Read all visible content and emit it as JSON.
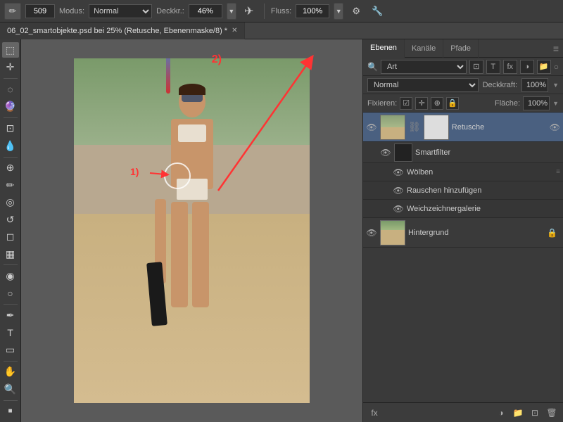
{
  "toolbar": {
    "brush_size": "509",
    "modus_label": "Modus:",
    "modus_value": "Normal",
    "deckkraft_label": "Deckkr.:",
    "deckkraft_value": "46%",
    "fluss_label": "Fluss:",
    "fluss_value": "100%"
  },
  "tab": {
    "title": "06_02_smartobjekte.psd bei 25% (Retusche, Ebenenmaske/8) *"
  },
  "canvas": {
    "annotation_1": "1)",
    "annotation_2": "2)"
  },
  "layers_panel": {
    "tabs": [
      "Ebenen",
      "Kanäle",
      "Pfade"
    ],
    "active_tab": "Ebenen",
    "filter_label": "Art",
    "blend_mode": "Normal",
    "deckkraft_label": "Deckkraft:",
    "deckkraft_value": "100%",
    "fixieren_label": "Fixieren:",
    "flache_label": "Fläche:",
    "flache_value": "100%",
    "layers": [
      {
        "name": "Retusche",
        "type": "layer",
        "active": true,
        "has_mask": true
      },
      {
        "name": "Smartfilter",
        "type": "sub",
        "indent": true
      },
      {
        "name": "Wölben",
        "type": "subsub"
      },
      {
        "name": "Rauschen hinzufügen",
        "type": "subsub"
      },
      {
        "name": "Weichzeichnergalerie",
        "type": "subsub"
      },
      {
        "name": "Hintergrund",
        "type": "layer",
        "locked": true
      }
    ]
  }
}
